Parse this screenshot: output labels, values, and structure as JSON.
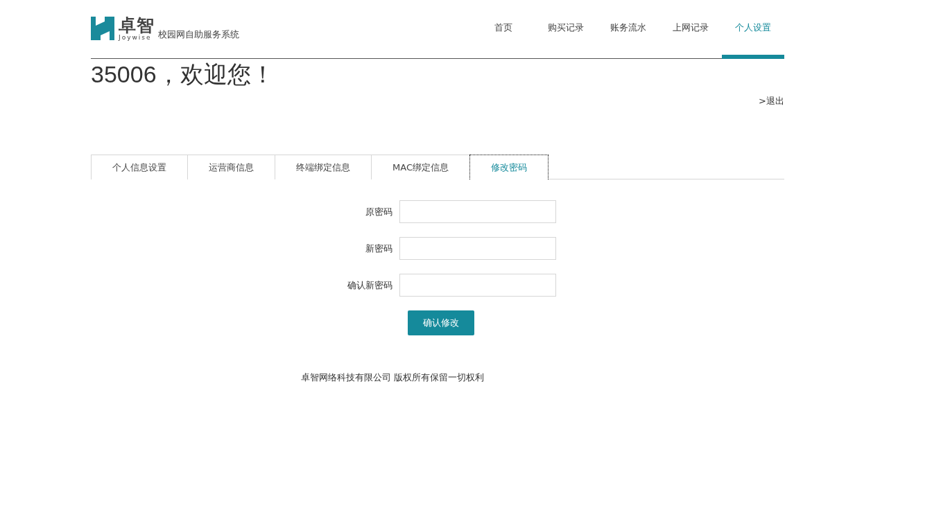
{
  "logo": {
    "name": "卓智",
    "latin": "Joywise",
    "subtitle": "校园网自助服务系统"
  },
  "nav": [
    {
      "label": "首页",
      "selected": false
    },
    {
      "label": "购买记录",
      "selected": false
    },
    {
      "label": "账务流水",
      "selected": false
    },
    {
      "label": "上网记录",
      "selected": false
    },
    {
      "label": "个人设置",
      "selected": true
    }
  ],
  "welcome": "35006，欢迎您！",
  "logout": ">退出",
  "tabs": [
    {
      "label": "个人信息设置",
      "selected": false
    },
    {
      "label": "运营商信息",
      "selected": false
    },
    {
      "label": "终端绑定信息",
      "selected": false
    },
    {
      "label": "MAC绑定信息",
      "selected": false
    },
    {
      "label": "修改密码",
      "selected": true
    }
  ],
  "form": {
    "fields": [
      {
        "label": "原密码"
      },
      {
        "label": "新密码"
      },
      {
        "label": "确认新密码"
      }
    ],
    "submit": "确认修改"
  },
  "footer": "卓智网络科技有限公司 版权所有保留一切权利"
}
